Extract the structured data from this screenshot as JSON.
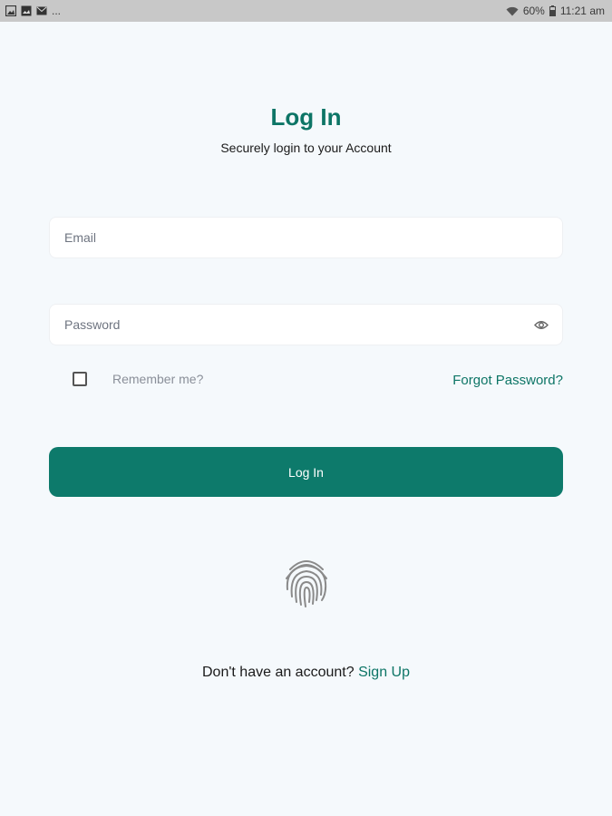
{
  "status_bar": {
    "left_ellipsis": "...",
    "battery": "60%",
    "time": "11:21 am"
  },
  "login": {
    "title": "Log In",
    "subtitle": "Securely login to your Account",
    "email_placeholder": "Email",
    "email_value": "",
    "password_placeholder": "Password",
    "password_value": "",
    "remember_label": "Remember me?",
    "remember_checked": false,
    "forgot_label": "Forgot Password?",
    "button_label": "Log In",
    "signup_prompt": "Don't have an account?",
    "signup_link": "Sign Up"
  },
  "colors": {
    "accent": "#0d7566",
    "button": "#0d7a6b",
    "background": "#f5f9fc",
    "status_bar": "#c8c8c8"
  },
  "icons": {
    "password_toggle": "eye-icon",
    "biometric": "fingerprint-icon",
    "wifi": "wifi-icon",
    "battery": "battery-icon"
  }
}
